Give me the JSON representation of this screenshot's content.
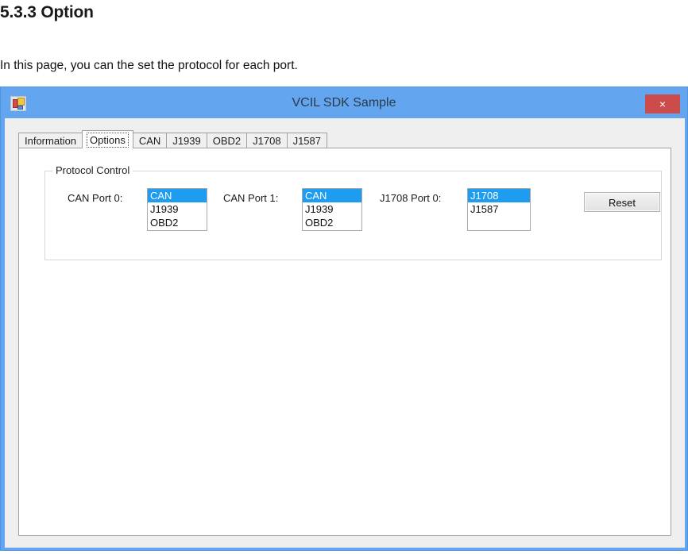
{
  "document": {
    "heading": "5.3.3 Option",
    "paragraph": "In this page, you can the set the protocol for each port."
  },
  "window": {
    "title": "VCIL SDK Sample",
    "icon_name": "windows-form-icon",
    "close_label": "×",
    "title_bar_color": "#63a5ef",
    "close_button_color": "#cc4c4c"
  },
  "tabs": [
    {
      "label": "Information",
      "selected": false
    },
    {
      "label": "Options",
      "selected": true
    },
    {
      "label": "CAN",
      "selected": false
    },
    {
      "label": "J1939",
      "selected": false
    },
    {
      "label": "OBD2",
      "selected": false
    },
    {
      "label": "J1708",
      "selected": false
    },
    {
      "label": "J1587",
      "selected": false
    }
  ],
  "group": {
    "title": "Protocol Control",
    "ports": [
      {
        "label": "CAN Port 0:",
        "options": [
          "CAN",
          "J1939",
          "OBD2"
        ],
        "selected": "CAN"
      },
      {
        "label": "CAN Port 1:",
        "options": [
          "CAN",
          "J1939",
          "OBD2"
        ],
        "selected": "CAN"
      },
      {
        "label": "J1708 Port 0:",
        "options": [
          "J1708",
          "J1587"
        ],
        "selected": "J1708"
      }
    ],
    "reset_label": "Reset",
    "selection_color": "#1e9cf0"
  }
}
